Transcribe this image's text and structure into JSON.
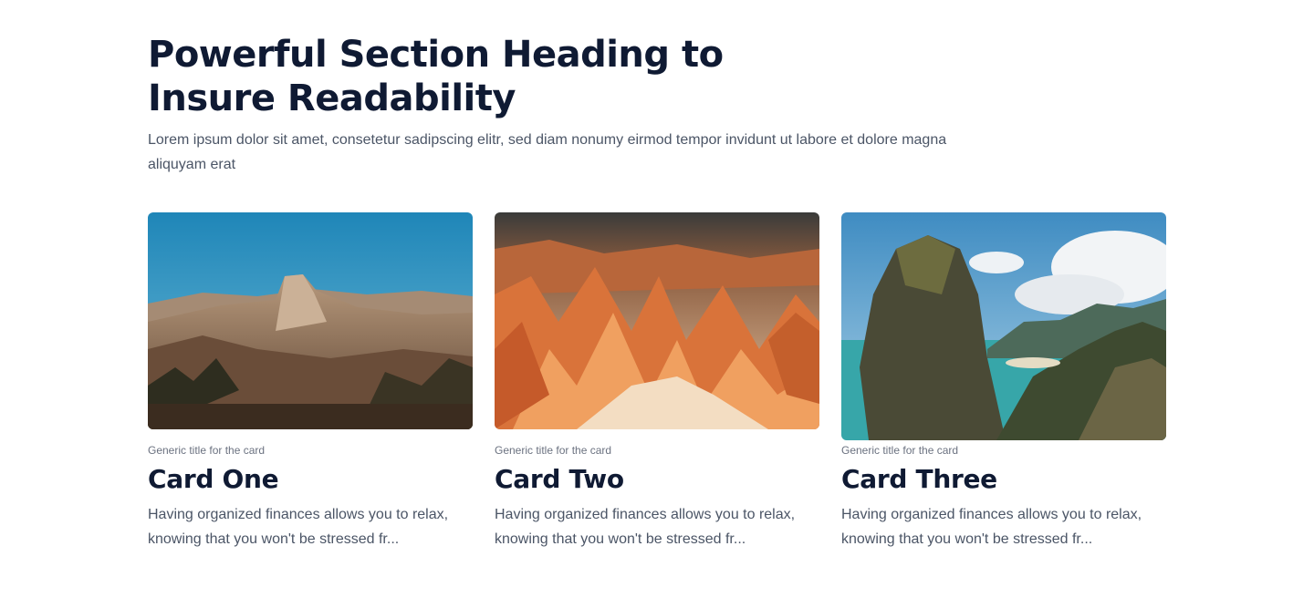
{
  "section": {
    "heading": "Powerful Section Heading to Insure Readability",
    "lead": "Lorem ipsum dolor sit amet, consetetur sadipscing elitr, sed diam nonumy eirmod tempor invidunt ut labore et dolore magna aliquyam erat"
  },
  "cards": [
    {
      "eyebrow": "Generic title for the card",
      "title": "Card One",
      "body": "Having organized finances allows you to relax, knowing that you won't be stressed fr..."
    },
    {
      "eyebrow": "Generic title for the card",
      "title": "Card Two",
      "body": "Having organized finances allows you to relax, knowing that you won't be stressed fr..."
    },
    {
      "eyebrow": "Generic title for the card",
      "title": "Card Three",
      "body": "Having organized finances allows you to relax, knowing that you won't be stressed fr..."
    }
  ]
}
